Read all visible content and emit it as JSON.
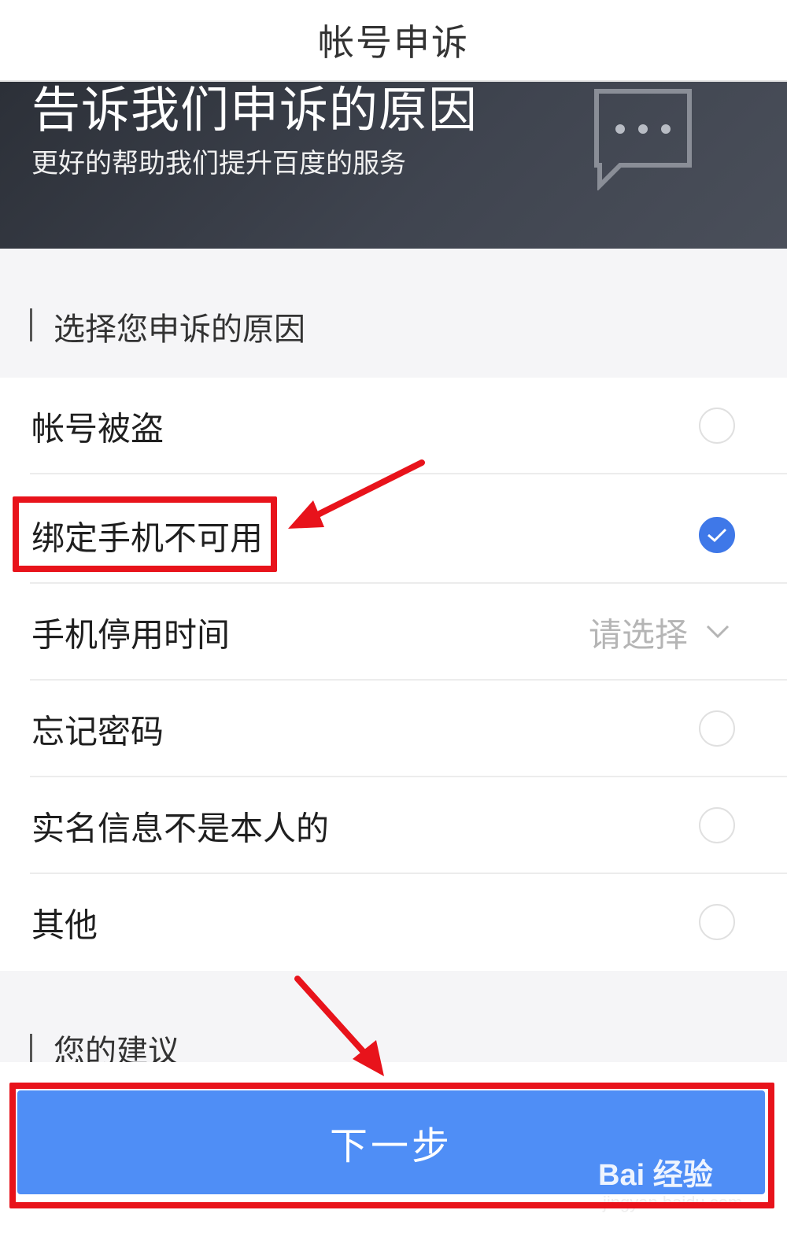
{
  "nav": {
    "title": "帐号申诉"
  },
  "banner": {
    "title": "告诉我们申诉的原因",
    "subtitle": "更好的帮助我们提升百度的服务",
    "icon": "chat-bubble-icon"
  },
  "section_reason": {
    "title": "选择您申诉的原因"
  },
  "reasons": [
    {
      "label": "帐号被盗",
      "checked": false
    },
    {
      "label": "绑定手机不可用",
      "checked": true
    },
    {
      "label": "手机停用时间",
      "select_placeholder": "请选择",
      "type": "select"
    },
    {
      "label": "忘记密码",
      "checked": false
    },
    {
      "label": "实名信息不是本人的",
      "checked": false
    },
    {
      "label": "其他",
      "checked": false
    }
  ],
  "section_suggestion": {
    "title": "您的建议"
  },
  "next_button": {
    "label": "下一步"
  },
  "watermark": {
    "logo": "Bai 经验",
    "url": "jingyan.baidu.com"
  },
  "colors": {
    "accent": "#4f8ef6",
    "check": "#3f78e8",
    "annotation": "#e8131b",
    "banner_dark": "#2c3038"
  }
}
